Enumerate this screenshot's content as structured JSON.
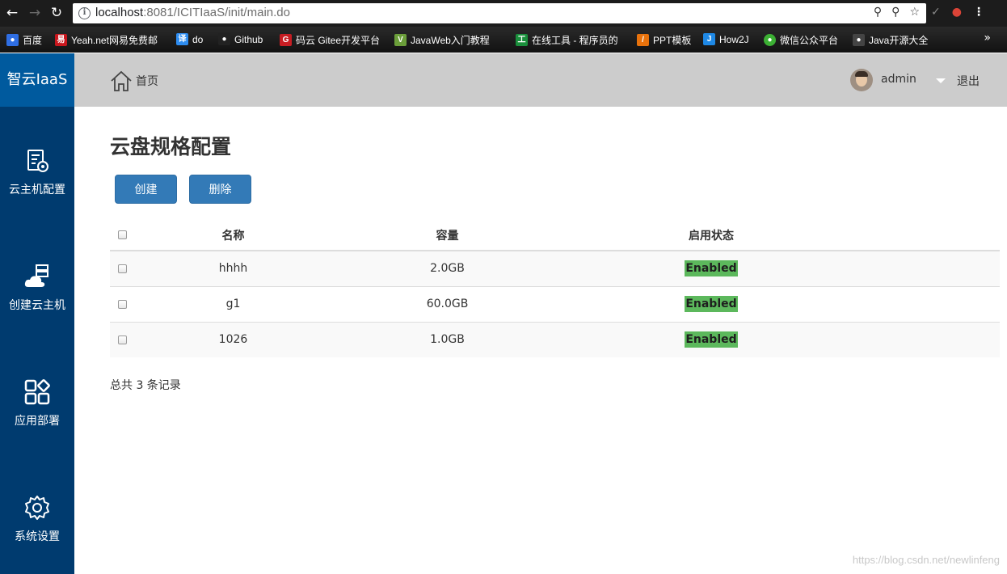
{
  "browser": {
    "url_host": "localhost",
    "url_rest": ":8081/ICITIaaS/init/main.do",
    "bookmarks": [
      {
        "label": "百度",
        "icon": "baidu-icon",
        "color": "#2f6ee3"
      },
      {
        "label": "Yeah.net网易免费邮",
        "icon": "netease-icon",
        "color": "#c8161d"
      },
      {
        "label": "do",
        "icon": "translate-icon",
        "color": "#2d8cf0"
      },
      {
        "label": "Github",
        "icon": "github-icon",
        "color": "#222222"
      },
      {
        "label": "码云 Gitee开发平台",
        "icon": "gitee-icon",
        "color": "#c71d23"
      },
      {
        "label": "JavaWeb入门教程",
        "icon": "javaweb-icon",
        "color": "#6b9e3a"
      },
      {
        "label": "在线工具 - 程序员的",
        "icon": "tool-icon",
        "color": "#1a8f3c"
      },
      {
        "label": "PPT模板",
        "icon": "ppt-icon",
        "color": "#e8720c"
      },
      {
        "label": "How2J",
        "icon": "how2j-icon",
        "color": "#1e88e5"
      },
      {
        "label": "微信公众平台",
        "icon": "wechat-icon",
        "color": "#3cb034"
      },
      {
        "label": "Java开源大全",
        "icon": "java-icon",
        "color": "#444444"
      }
    ]
  },
  "app": {
    "brand": "智云IaaS",
    "sidebar": [
      {
        "label": "云主机配置",
        "icon": "config-icon"
      },
      {
        "label": "创建云主机",
        "icon": "cloud-server-icon"
      },
      {
        "label": "应用部署",
        "icon": "apps-icon"
      },
      {
        "label": "系统设置",
        "icon": "gear-icon"
      }
    ],
    "breadcrumb": "首页",
    "user": "admin",
    "logout": "退出"
  },
  "main": {
    "title": "云盘规格配置",
    "create_label": "创建",
    "delete_label": "删除",
    "columns": {
      "name": "名称",
      "capacity": "容量",
      "status": "启用状态"
    },
    "rows": [
      {
        "name": "hhhh",
        "capacity": "2.0GB",
        "status": "Enabled"
      },
      {
        "name": "g1",
        "capacity": "60.0GB",
        "status": "Enabled"
      },
      {
        "name": "1026",
        "capacity": "1.0GB",
        "status": "Enabled"
      }
    ],
    "total_text": "总共 3 条记录"
  },
  "watermark": "https://blog.csdn.net/newlinfeng",
  "colors": {
    "sidebar": "#003b6f",
    "brand": "#005a9e",
    "button": "#337ab7",
    "badge": "#5cb85c"
  }
}
